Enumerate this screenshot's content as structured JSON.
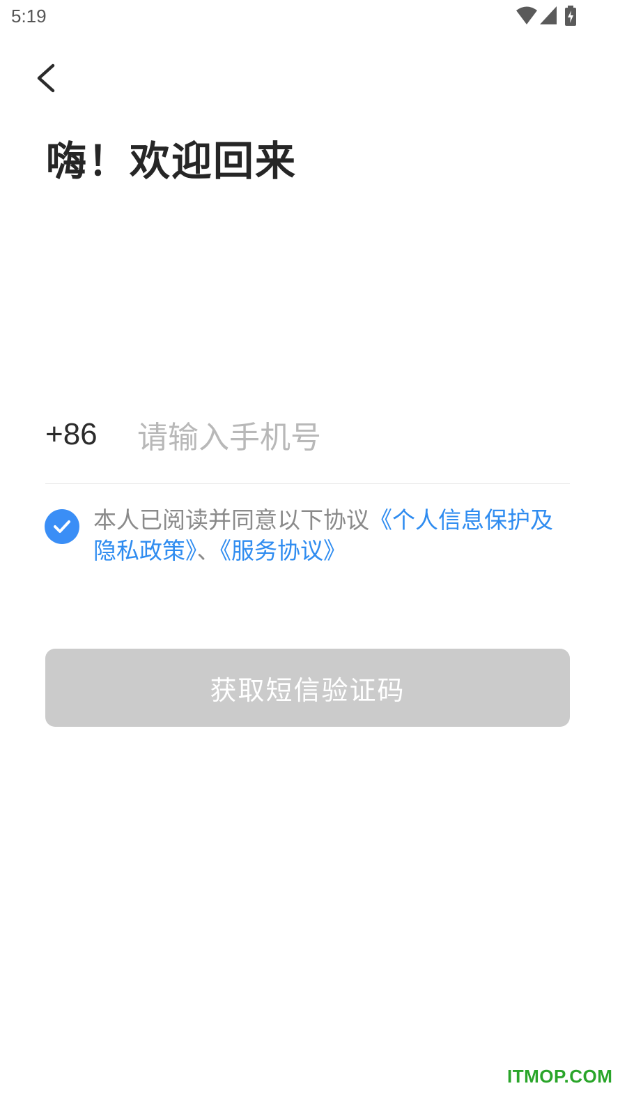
{
  "status_bar": {
    "time": "5:19",
    "icons": [
      "wifi-icon",
      "cell-signal-icon",
      "battery-charging-icon"
    ]
  },
  "header": {
    "back_icon": "chevron-left-icon",
    "title": "嗨！欢迎回来"
  },
  "phone": {
    "country_code": "+86",
    "placeholder": "请输入手机号",
    "value": ""
  },
  "agreement": {
    "checked": true,
    "prefix": "本人已阅读并同意以下协议",
    "privacy_link": "《个人信息保护及隐私政策》",
    "separator": "、",
    "service_link": "《服务协议》"
  },
  "actions": {
    "get_code_label": "获取短信验证码"
  },
  "watermark": {
    "text": "ITMOP.COM"
  },
  "colors": {
    "accent": "#3a8ef6",
    "link": "#2f8cf0",
    "button_disabled": "#cbcbcb",
    "watermark": "#2aa52a"
  }
}
